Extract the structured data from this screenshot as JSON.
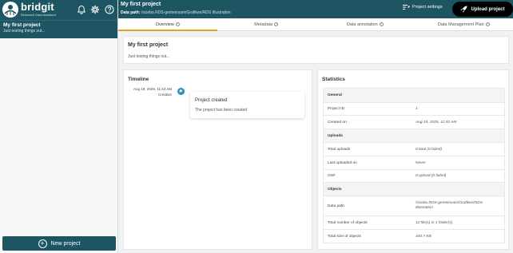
{
  "brand": {
    "name": "bridgit",
    "subtitle": "Research Data Assistant"
  },
  "sidebar": {
    "header_icons": [
      "bell-icon",
      "gear-icon",
      "help-icon"
    ],
    "projects": [
      {
        "title": "My first project",
        "description": "Just testing things out..."
      }
    ],
    "new_project_label": "New project"
  },
  "header": {
    "title": "My first project",
    "data_path_label": "Data path:",
    "data_path_value": "/sciebo.RDS-gemeinsam/Grafiken/RDS Illustration",
    "settings_label": "Project settings",
    "upload_label": "Upload project"
  },
  "tabs": [
    {
      "label": "Overview",
      "active": true
    },
    {
      "label": "Metadata",
      "active": false
    },
    {
      "label": "Data annotation",
      "active": false
    },
    {
      "label": "Data Management Plan",
      "active": false
    }
  ],
  "project_info": {
    "title": "My first project",
    "description": "Just testing things out..."
  },
  "timeline": {
    "title": "Timeline",
    "entries": [
      {
        "date": "Aug 19, 2025, 11:43 AM",
        "type": "Creation",
        "title": "Project created",
        "description": "The project has been created"
      }
    ]
  },
  "statistics": {
    "title": "Statistics",
    "sections": [
      {
        "name": "General",
        "rows": [
          {
            "key": "Project ID",
            "value": "1"
          },
          {
            "key": "Created on",
            "value": "Aug 19, 2025, 11:43 AM"
          }
        ]
      },
      {
        "name": "Uploads",
        "rows": [
          {
            "key": "Total uploads",
            "value": "0 total (0 failed)"
          },
          {
            "key": "Last uploaded on",
            "value": "Never"
          },
          {
            "key": "OSF",
            "value": "0 upload (0 failed)"
          }
        ]
      },
      {
        "name": "Objects",
        "rows": [
          {
            "key": "Data path",
            "value": "/sciebo.RDS-gemeinsam/Grafiken/RDS Illustration"
          },
          {
            "key": "Total number of objects",
            "value": "12 file(s) in 1 folder(s)"
          },
          {
            "key": "Total size of objects",
            "value": "440.7 KB"
          }
        ]
      }
    ]
  },
  "colors": {
    "primary": "#1d5562",
    "accent": "#e3a128",
    "timeline_dot": "#2a8fb0"
  }
}
